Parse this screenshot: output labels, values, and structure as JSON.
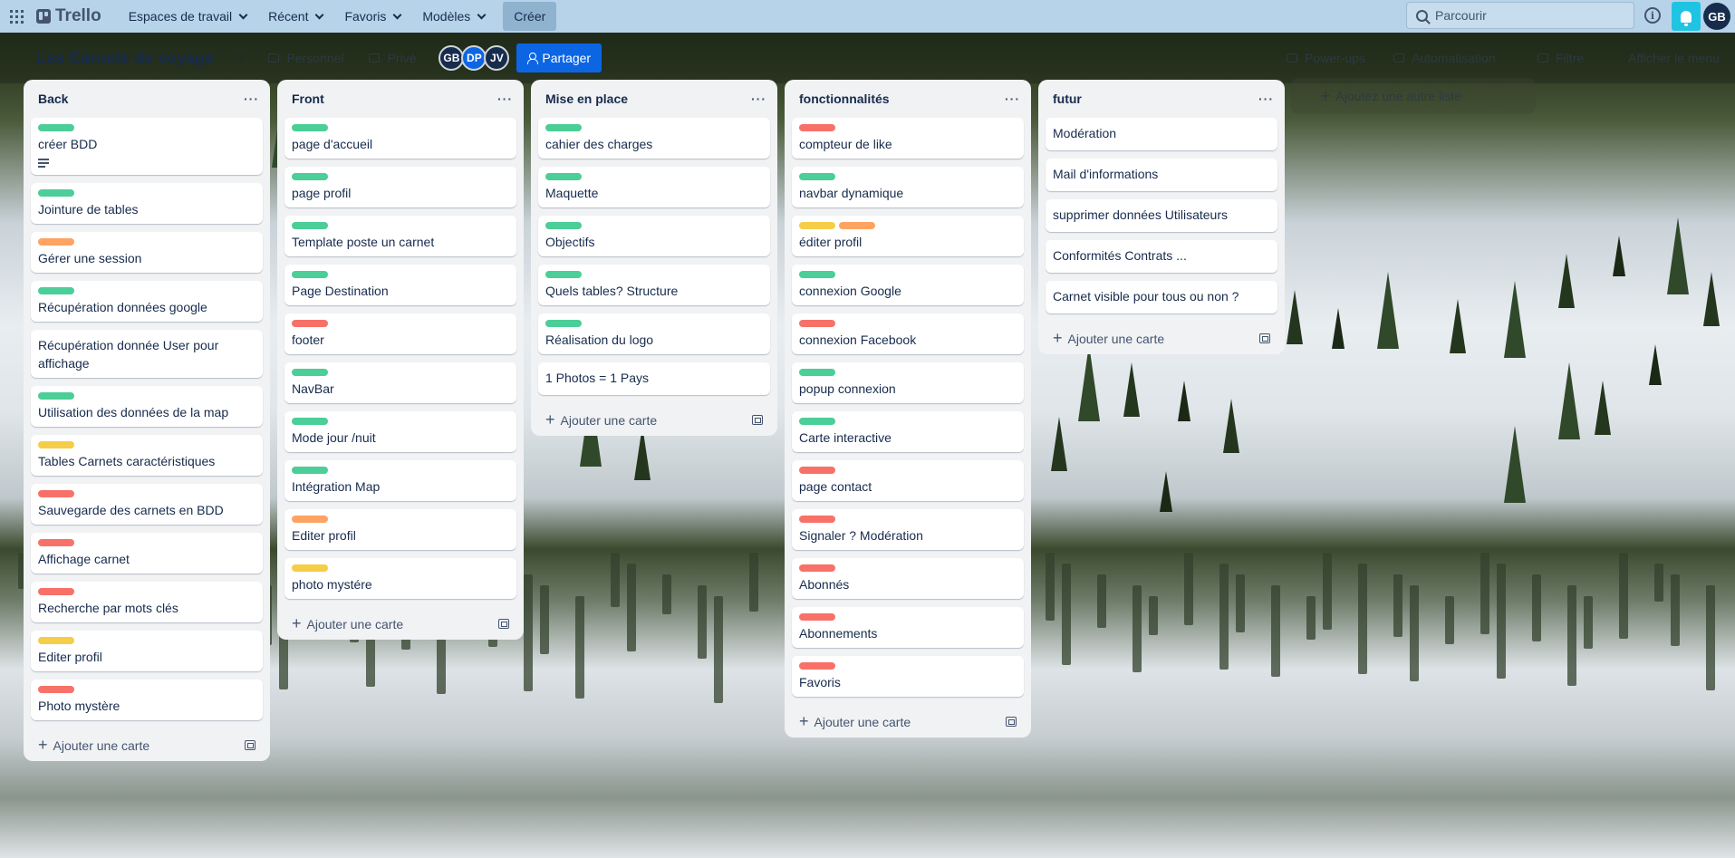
{
  "topbar": {
    "logo": "Trello",
    "nav": [
      "Espaces de travail",
      "Récent",
      "Favoris",
      "Modèles"
    ],
    "create": "Créer",
    "search_placeholder": "Parcourir",
    "user_initials": "GB"
  },
  "board": {
    "title": "Les Carnets de voyage",
    "visibility_workspace": "Personnel",
    "visibility": "Privé",
    "members": [
      "GB",
      "DP",
      "JV"
    ],
    "share": "Partager",
    "powerups": "Power-ups",
    "automation": "Automatisation",
    "filter": "Filtre",
    "menu": "Afficher le menu",
    "add_list": "Ajoutez une autre liste"
  },
  "colors": {
    "green": "#4bce97",
    "orange": "#fea362",
    "yellow": "#f5cd47",
    "red": "#f87168",
    "brand": "#0c66e4",
    "notify": "#1fc4e3"
  },
  "add_card_label": "Ajouter une carte",
  "lists": [
    {
      "title": "Back",
      "cards": [
        {
          "title": "créer BDD",
          "labels": [
            "green"
          ],
          "desc": true
        },
        {
          "title": "Jointure de tables",
          "labels": [
            "green"
          ]
        },
        {
          "title": "Gérer une session",
          "labels": [
            "orange"
          ]
        },
        {
          "title": "Récupération données google",
          "labels": [
            "green"
          ]
        },
        {
          "title": "Récupération donnée User pour affichage",
          "labels": []
        },
        {
          "title": "Utilisation des données de la map",
          "labels": [
            "green"
          ]
        },
        {
          "title": "Tables Carnets caractéristiques",
          "labels": [
            "yellow"
          ]
        },
        {
          "title": "Sauvegarde des carnets en BDD",
          "labels": [
            "red"
          ]
        },
        {
          "title": "Affichage carnet",
          "labels": [
            "red"
          ]
        },
        {
          "title": "Recherche par mots clés",
          "labels": [
            "red"
          ]
        },
        {
          "title": "Editer profil",
          "labels": [
            "yellow"
          ]
        },
        {
          "title": "Photo mystère",
          "labels": [
            "red"
          ]
        }
      ]
    },
    {
      "title": "Front",
      "cards": [
        {
          "title": "page d'accueil",
          "labels": [
            "green"
          ]
        },
        {
          "title": "page profil",
          "labels": [
            "green"
          ]
        },
        {
          "title": "Template poste un carnet",
          "labels": [
            "green"
          ]
        },
        {
          "title": "Page Destination",
          "labels": [
            "green"
          ]
        },
        {
          "title": "footer",
          "labels": [
            "red"
          ]
        },
        {
          "title": "NavBar",
          "labels": [
            "green"
          ]
        },
        {
          "title": "Mode jour /nuit",
          "labels": [
            "green"
          ]
        },
        {
          "title": "Intégration Map",
          "labels": [
            "green"
          ]
        },
        {
          "title": "Editer profil",
          "labels": [
            "orange"
          ]
        },
        {
          "title": "photo mystére",
          "labels": [
            "yellow"
          ]
        }
      ]
    },
    {
      "title": "Mise en place",
      "cards": [
        {
          "title": "cahier des charges",
          "labels": [
            "green"
          ]
        },
        {
          "title": "Maquette",
          "labels": [
            "green"
          ]
        },
        {
          "title": "Objectifs",
          "labels": [
            "green"
          ]
        },
        {
          "title": "Quels tables? Structure",
          "labels": [
            "green"
          ]
        },
        {
          "title": "Réalisation du logo",
          "labels": [
            "green"
          ]
        },
        {
          "title": "1 Photos = 1 Pays",
          "labels": []
        }
      ]
    },
    {
      "title": "fonctionnalités",
      "cards": [
        {
          "title": "compteur de like",
          "labels": [
            "red"
          ]
        },
        {
          "title": "navbar dynamique",
          "labels": [
            "green"
          ]
        },
        {
          "title": "éditer profil",
          "labels": [
            "yellow",
            "orange"
          ]
        },
        {
          "title": "connexion Google",
          "labels": [
            "green"
          ]
        },
        {
          "title": "connexion Facebook",
          "labels": [
            "red"
          ]
        },
        {
          "title": "popup connexion",
          "labels": [
            "green"
          ]
        },
        {
          "title": "Carte interactive",
          "labels": [
            "green"
          ]
        },
        {
          "title": "page contact",
          "labels": [
            "red"
          ]
        },
        {
          "title": "Signaler ? Modération",
          "labels": [
            "red"
          ]
        },
        {
          "title": "Abonnés",
          "labels": [
            "red"
          ]
        },
        {
          "title": "Abonnements",
          "labels": [
            "red"
          ]
        },
        {
          "title": "Favoris",
          "labels": [
            "red"
          ]
        }
      ]
    },
    {
      "title": "futur",
      "cards": [
        {
          "title": "Modération",
          "labels": []
        },
        {
          "title": "Mail d'informations",
          "labels": []
        },
        {
          "title": "supprimer données Utilisateurs",
          "labels": []
        },
        {
          "title": "Conformités Contrats ...",
          "labels": []
        },
        {
          "title": "Carnet visible pour tous ou non ?",
          "labels": []
        }
      ]
    }
  ]
}
